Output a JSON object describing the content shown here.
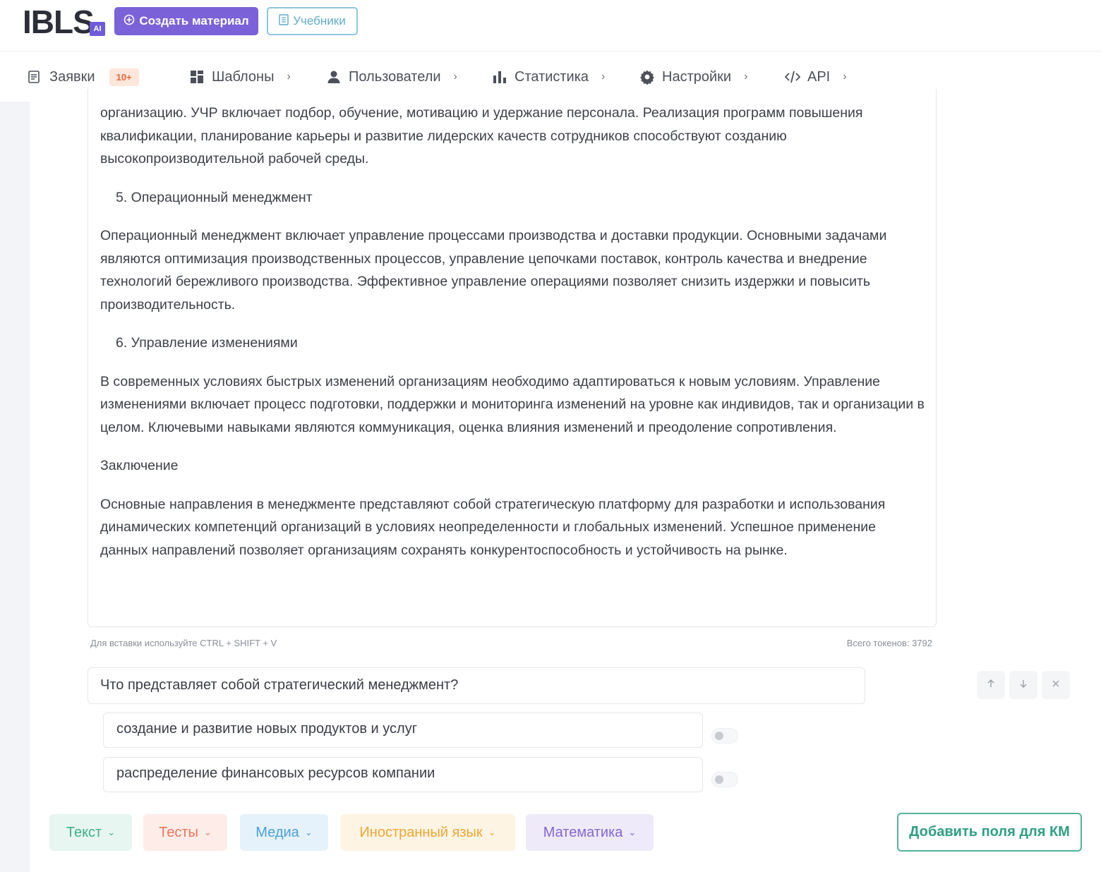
{
  "header": {
    "logo": "IBLS",
    "logo_badge": "AI",
    "create_button": "Создать материал",
    "textbooks_button": "Учебники"
  },
  "nav": {
    "requests": {
      "label": "Заявки",
      "badge": "10+"
    },
    "templates": "Шаблоны",
    "users": "Пользователи",
    "statistics": "Статистика",
    "settings": "Настройки",
    "api": "API"
  },
  "editor": {
    "p1": "организацию. УЧР включает подбор, обучение, мотивацию и удержание персонала. Реализация программ повышения квалификации, планирование карьеры и развитие лидерских качеств сотрудников способствуют созданию высокопроизводительной рабочей среды.",
    "h5": "5. Операционный менеджмент",
    "p5": "Операционный менеджмент включает управление процессами производства и доставки продукции. Основными задачами являются оптимизация производственных процессов, управление цепочками поставок, контроль качества и внедрение технологий бережливого производства. Эффективное управление операциями позволяет снизить издержки и повысить производительность.",
    "h6": "6. Управление изменениями",
    "p6": "В современных условиях быстрых изменений организациям необходимо адаптироваться к новым условиям. Управление изменениями включает процесс подготовки, поддержки и мониторинга изменений на уровне как индивидов, так и организации в целом. Ключевыми навыками являются коммуникация, оценка влияния изменений и преодоление сопротивления.",
    "conclusion_title": "Заключение",
    "conclusion": "Основные направления в менеджменте представляют собой стратегическую платформу для разработки и использования динамических компетенций организаций в условиях неопределенности и глобальных изменений. Успешное применение данных направлений позволяет организациям сохранять конкурентоспособность и устойчивость на рынке."
  },
  "hint": "Для вставки используйте CTRL + SHIFT + V",
  "tokens": "Всего токенов: 3792",
  "quiz": {
    "question": "Что представляет собой стратегический менеджмент?",
    "answers": [
      {
        "text": "создание и развитие новых продуктов и услуг",
        "correct": false
      },
      {
        "text": "распределение финансовых ресурсов компании",
        "correct": false
      }
    ]
  },
  "categories": [
    {
      "label": "Текст",
      "color": "#3fae8e",
      "bg": "#e7f6f0"
    },
    {
      "label": "Тесты",
      "color": "#e8755c",
      "bg": "#fdece8"
    },
    {
      "label": "Медиа",
      "color": "#4a9fd6",
      "bg": "#e6f2fb"
    },
    {
      "label": "Иностранный язык",
      "color": "#efa637",
      "bg": "#fdf4e4"
    },
    {
      "label": "Математика",
      "color": "#8366d0",
      "bg": "#efeaf9"
    }
  ],
  "km_button": "Добавить поля для КМ",
  "icons": [
    "plus-circle-icon",
    "book-icon",
    "document-icon",
    "grid-icon",
    "user-icon",
    "bar-chart-icon",
    "gear-icon",
    "code-icon",
    "chevron-right-icon",
    "arrow-up-icon",
    "arrow-down-icon",
    "close-icon",
    "chevron-down-icon"
  ]
}
